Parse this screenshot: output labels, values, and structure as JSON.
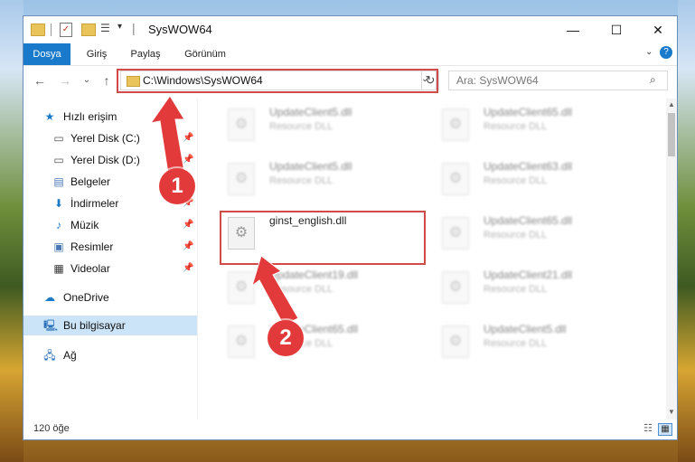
{
  "window": {
    "title": "SysWOW64",
    "controls": {
      "minimize": "—",
      "maximize": "☐",
      "close": "✕"
    }
  },
  "quick_access_toolbar": {
    "icons": [
      "folder-icon",
      "properties-check-icon",
      "new-folder-icon",
      "properties-icon",
      "dropdown-icon"
    ]
  },
  "ribbon": {
    "tabs": [
      "Dosya",
      "Giriş",
      "Paylaş",
      "Görünüm"
    ],
    "active_tab_color": "#1979ca"
  },
  "address_bar": {
    "path": "C:\\Windows\\SysWOW64"
  },
  "search": {
    "placeholder": "Ara: SysWOW64"
  },
  "sidebar": {
    "items": [
      {
        "label": "Hızlı erişim",
        "icon": "star-icon",
        "pinned": false
      },
      {
        "label": "Yerel Disk (C:)",
        "icon": "drive-icon",
        "pinned": true
      },
      {
        "label": "Yerel Disk (D:)",
        "icon": "drive-icon",
        "pinned": true
      },
      {
        "label": "Belgeler",
        "icon": "documents-icon",
        "pinned": true
      },
      {
        "label": "İndirmeler",
        "icon": "download-icon",
        "pinned": true
      },
      {
        "label": "Müzik",
        "icon": "music-icon",
        "pinned": true
      },
      {
        "label": "Resimler",
        "icon": "pictures-icon",
        "pinned": true
      },
      {
        "label": "Videolar",
        "icon": "videos-icon",
        "pinned": true
      },
      {
        "label": "OneDrive",
        "icon": "cloud-icon",
        "pinned": false
      },
      {
        "label": "Bu bilgisayar",
        "icon": "computer-icon",
        "pinned": false,
        "selected": true
      },
      {
        "label": "Ağ",
        "icon": "network-icon",
        "pinned": false
      }
    ]
  },
  "files": [
    {
      "name": "UpdateClient5.dll",
      "desc": "Resource DLL",
      "blurred": true
    },
    {
      "name": "UpdateClient65.dll",
      "desc": "Resource DLL",
      "blurred": true
    },
    {
      "name": "UpdateClient5.dll",
      "desc": "Resource DLL",
      "blurred": true
    },
    {
      "name": "UpdateClient63.dll",
      "desc": "Resource DLL",
      "blurred": true
    },
    {
      "name": "ginst_english.dll",
      "desc": "",
      "blurred": false,
      "highlighted": true
    },
    {
      "name": "UpdateClient65.dll",
      "desc": "Resource DLL",
      "blurred": true
    },
    {
      "name": "UpdateClient19.dll",
      "desc": "Resource DLL",
      "blurred": true
    },
    {
      "name": "UpdateClient21.dll",
      "desc": "Resource DLL",
      "blurred": true
    },
    {
      "name": "UpdateClient65.dll",
      "desc": "Resource DLL",
      "blurred": true
    },
    {
      "name": "UpdateClient5.dll",
      "desc": "Resource DLL",
      "blurred": true
    }
  ],
  "status_bar": {
    "item_count": "120 öğe"
  },
  "annotations": {
    "step1": "1",
    "step2": "2",
    "color": "#e23a3a"
  }
}
